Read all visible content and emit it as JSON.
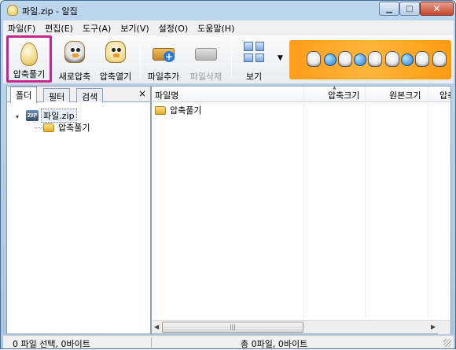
{
  "window": {
    "title": "파일.zip - 알집"
  },
  "menu": [
    "파일(F)",
    "편집(E)",
    "도구(A)",
    "보기(V)",
    "설정(O)",
    "도움말(H)"
  ],
  "toolbar": {
    "extract": "압축풀기",
    "new_archive": "새로압축",
    "open_archive": "압축열기",
    "add_file": "파일추가",
    "delete_file": "파일삭제",
    "view": "보기"
  },
  "left_panel": {
    "tabs": [
      "폴더",
      "필터",
      "검색"
    ],
    "close": "×",
    "tree": {
      "root": "파일.zip",
      "zip_badge": "ZIP",
      "child": "압축풀기"
    }
  },
  "file_list": {
    "columns": [
      "파일명",
      "압축크기",
      "원본크기",
      "압축"
    ],
    "rows": [
      {
        "name": "압축풀기"
      }
    ]
  },
  "status": {
    "left": "0 파일 선택,  0바이트",
    "right": "총 0파일,  0바이트"
  },
  "colors": {
    "highlight": "#c4278e",
    "banner": "#ff9c1c"
  }
}
